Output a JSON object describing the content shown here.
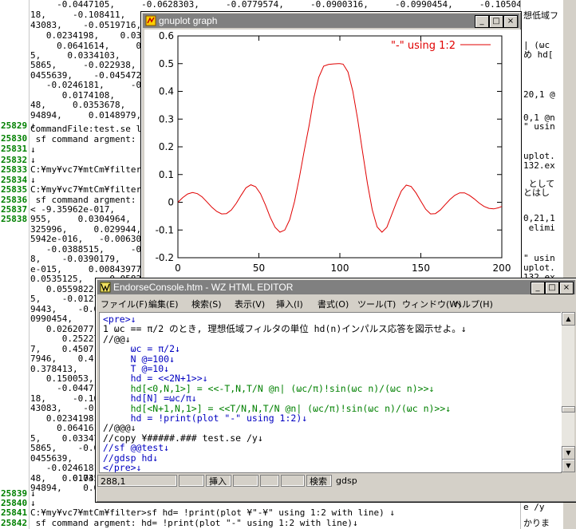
{
  "background": {
    "line_numbers": [
      {
        "n": "25829",
        "y": 152
      },
      {
        "n": "25830",
        "y": 168
      },
      {
        "n": "25831",
        "y": 181
      },
      {
        "n": "25832",
        "y": 195
      },
      {
        "n": "25833",
        "y": 207
      },
      {
        "n": "25834",
        "y": 220
      },
      {
        "n": "25835",
        "y": 232
      },
      {
        "n": "25836",
        "y": 245
      },
      {
        "n": "25837",
        "y": 257
      },
      {
        "n": "25838",
        "y": 269
      },
      {
        "n": "25839",
        "y": 613
      },
      {
        "n": "25840",
        "y": 625
      },
      {
        "n": "25841",
        "y": 637
      },
      {
        "n": "25842",
        "y": 650
      }
    ],
    "lines": [
      {
        "t": "     -0.0447105,     -0.0628303,     -0.0779574,     -0.0900316,     -0.0990454,     -0.105043,     -0.1081",
        "y": 0
      },
      {
        "t": "18,     -0.108411,",
        "y": 13
      },
      {
        "t": "43083,    -0.0519716,",
        "y": 26
      },
      {
        "t": "   0.0234198,    0.033606",
        "y": 39
      },
      {
        "t": "     0.0641614,     0.06",
        "y": 52
      },
      {
        "t": "5,     0.0334103,     0",
        "y": 64
      },
      {
        "t": "5865,     -0.022938,",
        "y": 76
      },
      {
        "t": "0455639,    -0.0454728,",
        "y": 89
      },
      {
        "t": "   -0.0246181,     -0.0187",
        "y": 101
      },
      {
        "t": "      0.0174108,     0.0",
        "y": 114
      },
      {
        "t": "48,     0.0353678,",
        "y": 126
      },
      {
        "t": "94894,     0.0148979,",
        "y": 139
      },
      {
        "t": "↓",
        "y": 152
      },
      {
        "t": "CommandFile:test.se lin",
        "y": 156
      },
      {
        "t": " sf command argment: ho",
        "y": 169
      },
      {
        "t": "↓",
        "y": 182
      },
      {
        "t": "↓",
        "y": 195
      },
      {
        "t": "C:¥my¥vc7¥mtCm¥filter>s",
        "y": 207
      },
      {
        "t": "↓",
        "y": 220
      },
      {
        "t": "C:¥my¥vc7¥mtCm¥filter>s",
        "y": 232
      },
      {
        "t": " sf command argment: ho",
        "y": 245
      },
      {
        "t": "< -9.35962e-017,     0.0",
        "y": 257
      },
      {
        "t": "955,     0.0304964,",
        "y": 269
      },
      {
        "t": "325996,     0.029944,",
        "y": 282
      },
      {
        "t": "5942e-016,   -0.0063031",
        "y": 294
      },
      {
        "t": "   -0.0388515,     -0.042",
        "y": 307
      },
      {
        "t": "8,    -0.0390179,     -0",
        "y": 319
      },
      {
        "t": "e-015,     0.00843977,",
        "y": 332
      },
      {
        "t": "0.0535125,     0.058217",
        "y": 344
      },
      {
        "t": "   0.0559822,",
        "y": 357
      },
      {
        "t": "5,    -0.01276",
        "y": 369
      },
      {
        "t": "9443,    -0.0",
        "y": 382
      },
      {
        "t": "0990454,",
        "y": 394
      },
      {
        "t": "   0.0262077,",
        "y": 407
      },
      {
        "t": "      0.252276",
        "y": 419
      },
      {
        "t": "7,    0.4507",
        "y": 432
      },
      {
        "t": "7946,    0.4",
        "y": 444
      },
      {
        "t": "0.378413,",
        "y": 457
      },
      {
        "t": "   0.150053,",
        "y": 469
      },
      {
        "t": "     -0.0447105",
        "y": 481
      },
      {
        "t": "18,     -0.108",
        "y": 494
      },
      {
        "t": "43083,    -0.0",
        "y": 506
      },
      {
        "t": "   0.0234198,",
        "y": 519
      },
      {
        "t": "     0.0641614,",
        "y": 531
      },
      {
        "t": "5,    0.03347",
        "y": 544
      },
      {
        "t": "5865,    -0.0",
        "y": 556
      },
      {
        "t": "0455639,    -0",
        "y": 569
      },
      {
        "t": "   -0.0246181,",
        "y": 581
      },
      {
        "t": "      0.0174108",
        "y": 594
      },
      {
        "t": "48,     0.0353",
        "y": 594
      },
      {
        "t": "94894,    0.014",
        "y": 606
      },
      {
        "t": "↓",
        "y": 613
      },
      {
        "t": "↓",
        "y": 625
      },
      {
        "t": "C:¥my¥vc7¥mtCm¥filter>sf hd= !print(plot ¥\"-¥\" using 1:2 with line) ↓",
        "y": 637
      },
      {
        "t": " sf command argment: hd= !print(plot \"-\" using 1:2 with line)↓",
        "y": 650
      }
    ],
    "right_panel": [
      {
        "t": "想低域フ",
        "y": 14
      },
      {
        "t": "| (ωc",
        "y": 51
      },
      {
        "t": "め hd[",
        "y": 63
      },
      {
        "t": "20,1 @",
        "y": 113
      },
      {
        "t": "0,1 @n",
        "y": 142
      },
      {
        "t": "\" usin",
        "y": 153
      },
      {
        "t": "uplot.",
        "y": 190
      },
      {
        "t": "132.ex",
        "y": 202
      },
      {
        "t": " として",
        "y": 225
      },
      {
        "t": "とはし",
        "y": 236
      },
      {
        "t": "0,21,1",
        "y": 268
      },
      {
        "t": " elimi",
        "y": 280
      },
      {
        "t": "\" usin",
        "y": 318
      },
      {
        "t": "uplot.",
        "y": 330
      },
      {
        "t": "132.ex",
        "y": 342
      },
      {
        "t": "e /y",
        "y": 630
      },
      {
        "t": "かりま",
        "y": 650
      }
    ]
  },
  "gnuplot": {
    "title": "gnuplot graph",
    "buttons": {
      "minimize": "_",
      "maximize": "□",
      "close": "×"
    }
  },
  "chart_data": {
    "type": "line",
    "title": "",
    "xlabel": "",
    "ylabel": "",
    "legend": "top-right",
    "xlim": [
      0,
      200
    ],
    "ylim": [
      -0.2,
      0.6
    ],
    "xticks": [
      0,
      50,
      100,
      150,
      200
    ],
    "yticks": [
      -0.2,
      -0.1,
      0,
      0.1,
      0.2,
      0.3,
      0.4,
      0.5,
      0.6
    ],
    "series": [
      {
        "name": "\"-\" using 1:2",
        "color": "#e00000",
        "x": [
          0,
          3,
          6,
          9,
          12,
          15,
          18,
          21,
          24,
          27,
          30,
          33,
          36,
          39,
          42,
          45,
          48,
          51,
          54,
          57,
          60,
          63,
          66,
          69,
          72,
          75,
          78,
          81,
          84,
          87,
          90,
          93,
          96,
          99,
          100,
          102,
          105,
          108,
          111,
          114,
          117,
          120,
          123,
          126,
          129,
          132,
          135,
          138,
          141,
          144,
          147,
          150,
          153,
          156,
          159,
          162,
          165,
          168,
          171,
          174,
          177,
          180,
          183,
          186,
          189,
          192,
          195,
          198,
          200
        ],
        "y": [
          0.0,
          0.017,
          0.03,
          0.035,
          0.031,
          0.019,
          0.001,
          -0.018,
          -0.033,
          -0.042,
          -0.041,
          -0.028,
          -0.004,
          0.025,
          0.052,
          0.063,
          0.056,
          0.031,
          -0.009,
          -0.054,
          -0.09,
          -0.108,
          -0.1,
          -0.063,
          0.003,
          0.09,
          0.185,
          0.276,
          0.378,
          0.451,
          0.491,
          0.497,
          0.499,
          0.5,
          0.5,
          0.498,
          0.47,
          0.401,
          0.3,
          0.183,
          0.069,
          -0.027,
          -0.089,
          -0.108,
          -0.09,
          -0.045,
          0.001,
          0.041,
          0.062,
          0.057,
          0.034,
          0.004,
          -0.025,
          -0.042,
          -0.041,
          -0.028,
          -0.009,
          0.01,
          0.025,
          0.034,
          0.034,
          0.025,
          0.012,
          -0.003,
          -0.015,
          -0.022,
          -0.024,
          -0.02,
          -0.015
        ]
      }
    ]
  },
  "editor": {
    "title": "EndorseConsole.htm - WZ HTML EDITOR",
    "buttons": {
      "minimize": "_",
      "maximize": "□",
      "close": "×"
    },
    "menu": [
      "ファイル(F)",
      "編集(E)",
      "検索(S)",
      "表示(V)",
      "挿入(I)",
      "書式(O)",
      "ツール(T)",
      "ウィンドウ(W)",
      "ヘルプ(H)"
    ],
    "lines": [
      {
        "t": "<pre>↓",
        "c": "blue"
      },
      {
        "t": "1 ωc == π/2 のとき, 理想低域フィルタの単位 hd(n)インパルス応答を図示せよ。↓",
        "c": "black"
      },
      {
        "t": "//@@↓",
        "c": "black"
      },
      {
        "t": "     ωc = π/2↓",
        "c": "blue"
      },
      {
        "t": "     N @=100↓",
        "c": "blue"
      },
      {
        "t": "     T @=10↓",
        "c": "blue"
      },
      {
        "t": "     hd = <<2N+1>>↓",
        "c": "blue"
      },
      {
        "t": "     hd[<0,N,1>] = <<-T,N,T/N @n| (ωc/π)!sin(ωc n)/(ωc n)>>↓",
        "c": "green"
      },
      {
        "t": "     hd[N] =ωc/π↓",
        "c": "blue"
      },
      {
        "t": "     hd[<N+1,N,1>] = <<T/N,N,T/N @n| (ωc/π)!sin(ωc n)/(ωc n)>>↓",
        "c": "green"
      },
      {
        "t": "     hd = !print(plot \"-\" using 1:2)↓",
        "c": "blue"
      },
      {
        "t": "//@@@↓",
        "c": "black"
      },
      {
        "t": "//copy ¥#####.### test.se /y↓",
        "c": "black"
      },
      {
        "t": "//sf @@test↓",
        "c": "blue"
      },
      {
        "t": "//gdsp hd↓",
        "c": "blue"
      },
      {
        "t": "</pre>↓",
        "c": "blue"
      }
    ],
    "status": {
      "position": "288,1",
      "mode": "挿入",
      "search_label": "検索",
      "search_value": "gdsp"
    }
  }
}
